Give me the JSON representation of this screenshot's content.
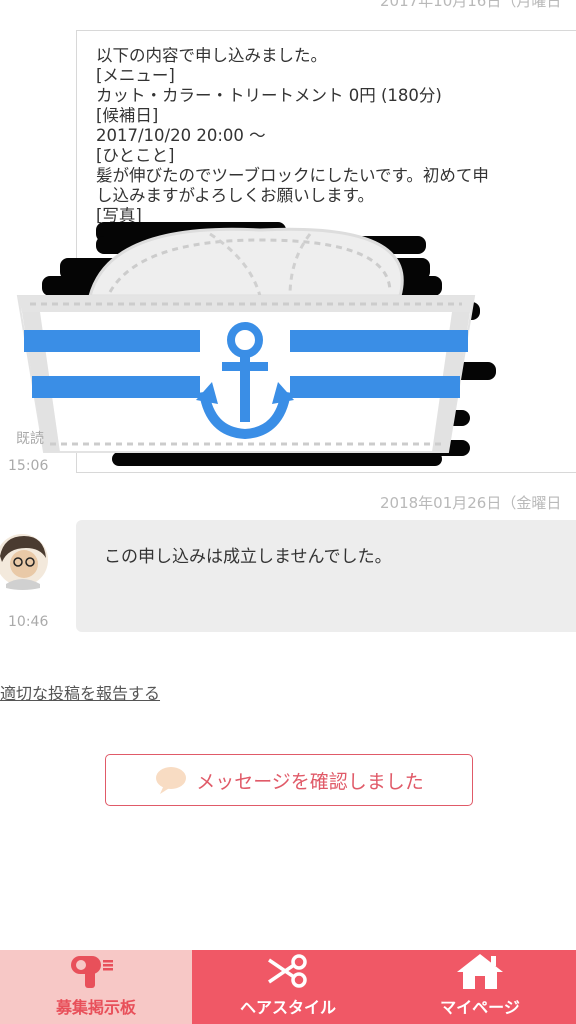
{
  "date_top": "2017年10月16日（月曜日",
  "date_mid": "2018年01月26日（金曜日",
  "sent_message": {
    "lines": [
      "以下の内容で申し込みました。",
      "[メニュー]",
      "カット・カラー・トリートメント 0円 (180分)",
      "[候補日]",
      "2017/10/20 20:00 〜",
      "[ひとこと]",
      "髪が伸びたのでツーブロックにしたいです。初めて申",
      "し込みますがよろしくお願いします。",
      "[写真]"
    ],
    "read_label": "既読",
    "time": "15:06"
  },
  "received_message": {
    "text": "この申し込みは成立しませんでした。",
    "time": "10:46"
  },
  "report_link": "適切な投稿を報告する",
  "confirm_button": "メッセージを確認しました",
  "tabs": [
    {
      "label": "募集掲示板",
      "icon": "hair-dryer-icon"
    },
    {
      "label": "ヘアスタイル",
      "icon": "scissors-icon"
    },
    {
      "label": "マイページ",
      "icon": "home-icon"
    }
  ],
  "colors": {
    "accent": "#f05866",
    "tab_active_bg": "#f7c8c6",
    "hat_blue": "#3a8ee6"
  }
}
